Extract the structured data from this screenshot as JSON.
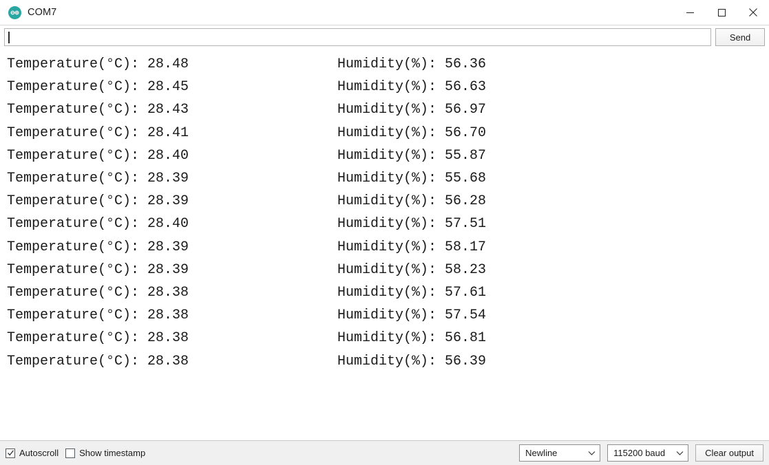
{
  "window": {
    "title": "COM7",
    "app_icon": "arduino-logo-icon",
    "controls": {
      "minimize": "minimize-icon",
      "maximize": "maximize-icon",
      "close": "close-icon"
    }
  },
  "send_row": {
    "input_value": "",
    "input_placeholder": "",
    "send_label": "Send"
  },
  "output": {
    "temperature_label": "Temperature(°C):",
    "humidity_label": "Humidity(%):",
    "rows": [
      {
        "temperature": "28.48",
        "humidity": "56.36"
      },
      {
        "temperature": "28.45",
        "humidity": "56.63"
      },
      {
        "temperature": "28.43",
        "humidity": "56.97"
      },
      {
        "temperature": "28.41",
        "humidity": "56.70"
      },
      {
        "temperature": "28.40",
        "humidity": "55.87"
      },
      {
        "temperature": "28.39",
        "humidity": "55.68"
      },
      {
        "temperature": "28.39",
        "humidity": "56.28"
      },
      {
        "temperature": "28.40",
        "humidity": "57.51"
      },
      {
        "temperature": "28.39",
        "humidity": "58.17"
      },
      {
        "temperature": "28.39",
        "humidity": "58.23"
      },
      {
        "temperature": "28.38",
        "humidity": "57.61"
      },
      {
        "temperature": "28.38",
        "humidity": "57.54"
      },
      {
        "temperature": "28.38",
        "humidity": "56.81"
      },
      {
        "temperature": "28.38",
        "humidity": "56.39"
      }
    ]
  },
  "status_bar": {
    "autoscroll_label": "Autoscroll",
    "autoscroll_checked": true,
    "show_timestamp_label": "Show timestamp",
    "show_timestamp_checked": false,
    "line_ending_value": "Newline",
    "baud_value": "115200 baud",
    "clear_output_label": "Clear output"
  },
  "colors": {
    "arduino_teal": "#2ba7a3",
    "window_bg": "#ffffff",
    "statusbar_bg": "#f0f0f0",
    "text": "#1a1a1a",
    "border": "#c8c8c8"
  }
}
